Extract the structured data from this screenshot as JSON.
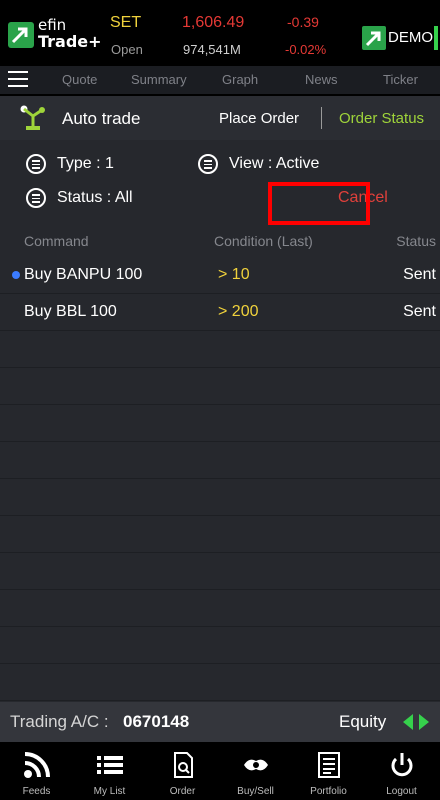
{
  "header": {
    "logo": {
      "line1": "efin",
      "line2": "Trade+"
    },
    "market": {
      "name": "SET",
      "state": "Open",
      "index": "1,606.49",
      "volume": "974,541M",
      "change": "-0.39",
      "change_pct": "-0.02%"
    },
    "mode_badge": "DEMO"
  },
  "nav": {
    "items": [
      "Quote",
      "Summary",
      "Graph",
      "News",
      "Ticker"
    ]
  },
  "subheader": {
    "title": "Auto trade",
    "place_order": "Place Order",
    "order_status": "Order Status"
  },
  "filters": {
    "type": "Type : 1",
    "view": "View : Active",
    "status": "Status : All",
    "cancel": "Cancel"
  },
  "table": {
    "headers": {
      "command": "Command",
      "condition": "Condition (Last)",
      "status": "Status"
    },
    "rows": [
      {
        "command": "Buy BANPU 100",
        "condition": "> 10",
        "status": "Sent"
      },
      {
        "command": "Buy BBL 100",
        "condition": "> 200",
        "status": "Sent"
      }
    ]
  },
  "account": {
    "label": "Trading A/C : ",
    "number": "0670148",
    "type": "Equity"
  },
  "tabbar": {
    "items": [
      "Feeds",
      "My List",
      "Order",
      "Buy/Sell",
      "Portfolio",
      "Logout"
    ]
  },
  "colors": {
    "accent_green": "#9fd43a",
    "price_down": "#e53935",
    "highlight_yellow": "#f0d23c",
    "annotation_red": "#ff0000"
  }
}
